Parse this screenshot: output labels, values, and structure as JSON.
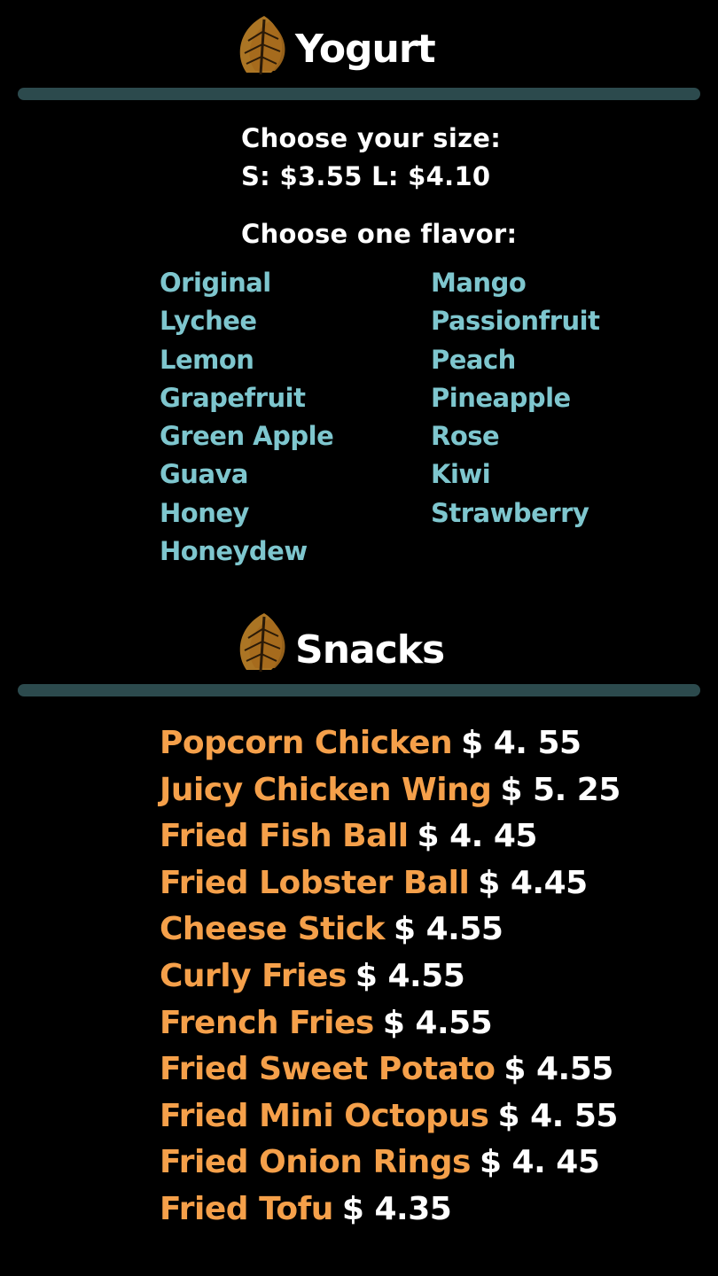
{
  "colors": {
    "background": "#000000",
    "divider": "#2c4a4d",
    "flavor_text": "#7ec6ce",
    "snack_name": "#f5a04a",
    "heading_text": "#ffffff"
  },
  "yogurt": {
    "title": "Yogurt",
    "icon": "leaf-icon",
    "size_heading": "Choose your size:",
    "size_prices": "S: $3.55 L: $4.10",
    "flavor_heading": "Choose one flavor:",
    "flavors_left": [
      "Original",
      "Lychee",
      "Lemon",
      "Grapefruit",
      "Green Apple",
      "Guava",
      "Honey",
      "Honeydew"
    ],
    "flavors_right": [
      "Mango",
      "Passionfruit",
      "Peach",
      "Pineapple",
      "Rose",
      "Kiwi",
      "Strawberry"
    ]
  },
  "snacks": {
    "title": "Snacks",
    "icon": "leaf-icon",
    "items": [
      {
        "name": "Popcorn Chicken",
        "price": "$ 4. 55"
      },
      {
        "name": "Juicy Chicken Wing",
        "price": "$ 5. 25"
      },
      {
        "name": "Fried Fish Ball",
        "price": "$ 4. 45"
      },
      {
        "name": "Fried Lobster Ball",
        "price": "$ 4.45"
      },
      {
        "name": "Cheese Stick",
        "price": "$ 4.55"
      },
      {
        "name": "Curly Fries",
        "price": "$ 4.55"
      },
      {
        "name": "French Fries",
        "price": "$ 4.55"
      },
      {
        "name": "Fried Sweet Potato",
        "price": "$ 4.55"
      },
      {
        "name": "Fried Mini Octopus",
        "price": "$ 4. 55"
      },
      {
        "name": "Fried Onion Rings",
        "price": "$ 4. 45"
      },
      {
        "name": "Fried Tofu",
        "price": "$ 4.35"
      }
    ]
  }
}
